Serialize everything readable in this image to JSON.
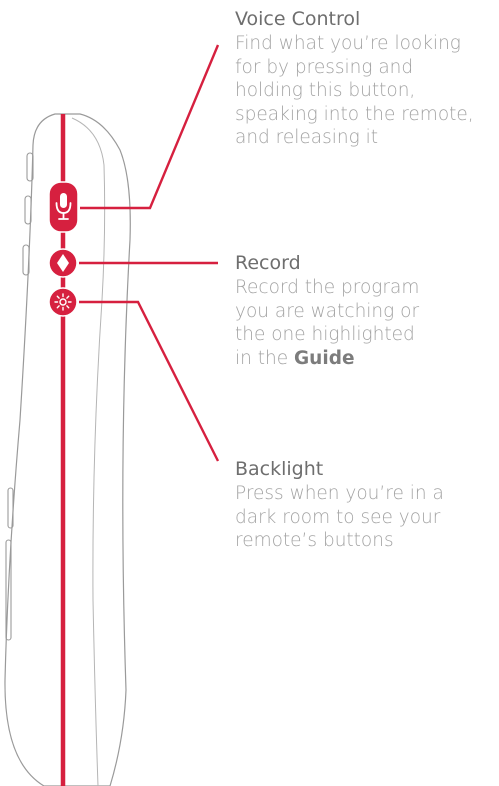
{
  "colors": {
    "accent": "#d6203f",
    "outline": "#9a9a9a",
    "title_text": "#6e6e6e",
    "body_text": "#a3a3a3"
  },
  "icons": [
    "microphone-icon",
    "record-diamond-icon",
    "backlight-sun-icon"
  ],
  "callouts": {
    "voice": {
      "title": "Voice Control",
      "lines": [
        "Find what you’re looking",
        "for by pressing and",
        "holding this button,",
        "speaking into the remote,",
        "and releasing it"
      ]
    },
    "record": {
      "title": "Record",
      "lines": [
        "Record the program",
        "you are watching or",
        "the one highlighted"
      ],
      "last_line_prefix": "in the ",
      "last_line_bold": "Guide"
    },
    "backlight": {
      "title": "Backlight",
      "lines": [
        "Press when you’re in a",
        "dark room to see your",
        "remote’s buttons"
      ]
    }
  }
}
